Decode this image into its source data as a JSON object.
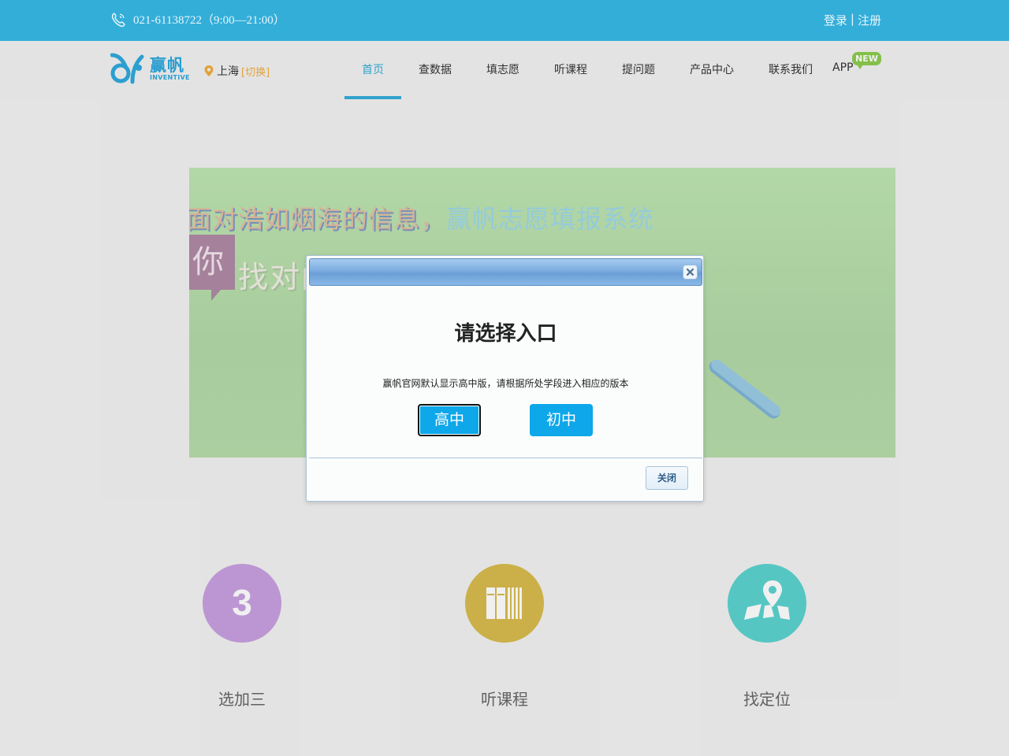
{
  "topbar": {
    "phone": "021-61138722（9:00—21:00）",
    "login": "登录",
    "separator": "|",
    "register": "注册"
  },
  "logo": {
    "name_cn": "赢帆",
    "name_en": "INVENTIVE"
  },
  "location": {
    "city": "上海",
    "switch_label": "[切换]"
  },
  "nav": {
    "items": [
      {
        "label": "首页",
        "active": true
      },
      {
        "label": "查数据"
      },
      {
        "label": "填志愿"
      },
      {
        "label": "听课程"
      },
      {
        "label": "提问题"
      },
      {
        "label": "产品中心"
      },
      {
        "label": "联系我们"
      },
      {
        "label": "APP",
        "badge": "NEW"
      }
    ]
  },
  "banner": {
    "line1_a": "面对浩如烟海的信息，",
    "line1_b": "赢帆志愿填报系统",
    "speech": "你",
    "line2": "找对门路"
  },
  "features": [
    {
      "label": "选加三",
      "icon": "number-3-icon",
      "color": "#c8a0e0"
    },
    {
      "label": "听课程",
      "icon": "books-icon",
      "color": "#d8bc4e"
    },
    {
      "label": "找定位",
      "icon": "map-pin-icon",
      "color": "#5cd3d0"
    }
  ],
  "modal": {
    "title": "请选择入口",
    "message": "赢帆官网默认显示高中版，请根据所处学段进入相应的版本",
    "option_high": "高中",
    "option_middle": "初中",
    "close_label": "关闭"
  },
  "colors": {
    "brand_blue": "#33aed9",
    "modal_button": "#0ea7ea",
    "new_badge": "#8dcc4e",
    "switch_orange": "#f0ad3e"
  }
}
